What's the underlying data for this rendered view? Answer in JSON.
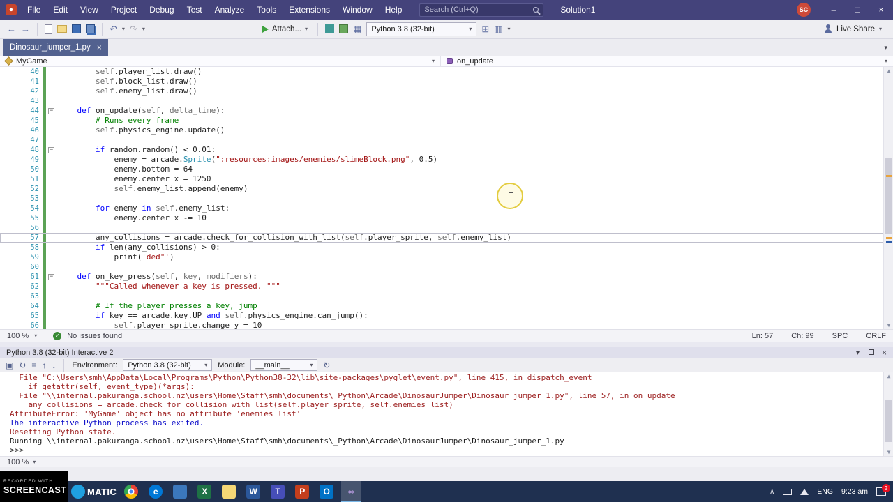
{
  "titlebar": {
    "menus": [
      "File",
      "Edit",
      "View",
      "Project",
      "Debug",
      "Test",
      "Analyze",
      "Tools",
      "Extensions",
      "Window",
      "Help"
    ],
    "search_placeholder": "Search (Ctrl+Q)",
    "solution": "Solution1",
    "avatar_initials": "SC"
  },
  "toolbar": {
    "attach_label": "Attach...",
    "python_version": "Python 3.8 (32-bit)",
    "live_share_label": "Live Share"
  },
  "tabbar": {
    "tabs": [
      {
        "label": "Dinosaur_jumper_1.py"
      }
    ]
  },
  "breadcrumb": {
    "left": "MyGame",
    "right": "on_update"
  },
  "editor": {
    "current_line": 57,
    "lines": [
      {
        "n": 40,
        "seg": [
          [
            "p",
            "        "
          ],
          [
            "g",
            "self"
          ],
          [
            "p",
            ".player_list.draw()"
          ]
        ]
      },
      {
        "n": 41,
        "seg": [
          [
            "p",
            "        "
          ],
          [
            "g",
            "self"
          ],
          [
            "p",
            ".block_list.draw()"
          ]
        ]
      },
      {
        "n": 42,
        "seg": [
          [
            "p",
            "        "
          ],
          [
            "g",
            "self"
          ],
          [
            "p",
            ".enemy_list.draw()"
          ]
        ]
      },
      {
        "n": 43,
        "seg": []
      },
      {
        "n": 44,
        "fold": true,
        "seg": [
          [
            "p",
            "    "
          ],
          [
            "k",
            "def"
          ],
          [
            "p",
            " on_update("
          ],
          [
            "g",
            "self"
          ],
          [
            "p",
            ", "
          ],
          [
            "g",
            "delta_time"
          ],
          [
            "p",
            "):"
          ]
        ]
      },
      {
        "n": 45,
        "seg": [
          [
            "p",
            "        "
          ],
          [
            "c",
            "# Runs every frame"
          ]
        ]
      },
      {
        "n": 46,
        "seg": [
          [
            "p",
            "        "
          ],
          [
            "g",
            "self"
          ],
          [
            "p",
            ".physics_engine.update()"
          ]
        ]
      },
      {
        "n": 47,
        "seg": []
      },
      {
        "n": 48,
        "fold": true,
        "seg": [
          [
            "p",
            "        "
          ],
          [
            "k",
            "if"
          ],
          [
            "p",
            " random.random() < 0.01:"
          ]
        ]
      },
      {
        "n": 49,
        "seg": [
          [
            "p",
            "            enemy = arcade."
          ],
          [
            "t",
            "Sprite"
          ],
          [
            "p",
            "("
          ],
          [
            "s",
            "\":resources:images/enemies/slimeBlock.png\""
          ],
          [
            "p",
            ", 0.5)"
          ]
        ]
      },
      {
        "n": 50,
        "seg": [
          [
            "p",
            "            enemy.bottom = 64"
          ]
        ]
      },
      {
        "n": 51,
        "seg": [
          [
            "p",
            "            enemy.center_x = 1250"
          ]
        ]
      },
      {
        "n": 52,
        "seg": [
          [
            "p",
            "            "
          ],
          [
            "g",
            "self"
          ],
          [
            "p",
            ".enemy_list.append(enemy)"
          ]
        ]
      },
      {
        "n": 53,
        "seg": []
      },
      {
        "n": 54,
        "seg": [
          [
            "p",
            "        "
          ],
          [
            "k",
            "for"
          ],
          [
            "p",
            " enemy "
          ],
          [
            "k",
            "in"
          ],
          [
            "p",
            " "
          ],
          [
            "g",
            "self"
          ],
          [
            "p",
            ".enemy_list:"
          ]
        ]
      },
      {
        "n": 55,
        "seg": [
          [
            "p",
            "            enemy.center_x -= 10"
          ]
        ]
      },
      {
        "n": 56,
        "seg": []
      },
      {
        "n": 57,
        "seg": [
          [
            "p",
            "        any_collisions = arcade.check_for_collision_with_list("
          ],
          [
            "g",
            "self"
          ],
          [
            "p",
            ".player_sprite, "
          ],
          [
            "g",
            "self"
          ],
          [
            "p",
            ".enemy_list)"
          ]
        ]
      },
      {
        "n": 58,
        "seg": [
          [
            "p",
            "        "
          ],
          [
            "k",
            "if"
          ],
          [
            "p",
            " len(any_collisions) > 0:"
          ]
        ]
      },
      {
        "n": 59,
        "seg": [
          [
            "p",
            "            print("
          ],
          [
            "s",
            "'ded\"'"
          ],
          [
            "p",
            ")"
          ]
        ]
      },
      {
        "n": 60,
        "seg": []
      },
      {
        "n": 61,
        "fold": true,
        "seg": [
          [
            "p",
            "    "
          ],
          [
            "k",
            "def"
          ],
          [
            "p",
            " on_key_press("
          ],
          [
            "g",
            "self"
          ],
          [
            "p",
            ", "
          ],
          [
            "g",
            "key"
          ],
          [
            "p",
            ", "
          ],
          [
            "g",
            "modifiers"
          ],
          [
            "p",
            "):"
          ]
        ]
      },
      {
        "n": 62,
        "seg": [
          [
            "p",
            "        "
          ],
          [
            "s",
            "\"\"\"Called whenever a key is pressed. \"\"\""
          ]
        ]
      },
      {
        "n": 63,
        "seg": []
      },
      {
        "n": 64,
        "seg": [
          [
            "p",
            "        "
          ],
          [
            "c",
            "# If the player presses a key, jump"
          ]
        ]
      },
      {
        "n": 65,
        "seg": [
          [
            "p",
            "        "
          ],
          [
            "k",
            "if"
          ],
          [
            "p",
            " key == arcade.key.UP "
          ],
          [
            "k",
            "and"
          ],
          [
            "p",
            " "
          ],
          [
            "g",
            "self"
          ],
          [
            "p",
            ".physics_engine.can_jump():"
          ]
        ]
      },
      {
        "n": 66,
        "seg": [
          [
            "p",
            "            "
          ],
          [
            "g",
            "self"
          ],
          [
            "p",
            ".player_sprite.change_y = 10"
          ]
        ]
      }
    ]
  },
  "editor_status": {
    "zoom": "100 %",
    "issues": "No issues found",
    "ln": "Ln: 57",
    "ch": "Ch: 99",
    "enc": "SPC",
    "eol": "CRLF"
  },
  "interactive": {
    "title": "Python 3.8 (32-bit) Interactive 2",
    "environment_label": "Environment:",
    "environment_value": "Python 3.8 (32-bit)",
    "module_label": "Module:",
    "module_value": "__main__",
    "console": [
      {
        "c": "err",
        "t": "  File \"C:\\Users\\smh\\AppData\\Local\\Programs\\Python\\Python38-32\\lib\\site-packages\\pyglet\\event.py\", line 415, in dispatch_event"
      },
      {
        "c": "err",
        "t": "    if getattr(self, event_type)(*args):"
      },
      {
        "c": "err",
        "t": "  File \"\\\\internal.pakuranga.school.nz\\users\\Home\\Staff\\smh\\documents\\_Python\\Arcade\\DinosaurJumper\\Dinosaur_jumper_1.py\", line 57, in on_update"
      },
      {
        "c": "err",
        "t": "    any_collisions = arcade.check_for_collision_with_list(self.player_sprite, self.enemies_list)"
      },
      {
        "c": "err",
        "t": "AttributeError: 'MyGame' object has no attribute 'enemies_list'"
      },
      {
        "c": "info",
        "t": "The interactive Python process has exited."
      },
      {
        "c": "err",
        "t": "Resetting Python state."
      },
      {
        "c": "plain",
        "t": "Running \\\\internal.pakuranga.school.nz\\users\\Home\\Staff\\smh\\documents\\_Python\\Arcade\\DinosaurJumper\\Dinosaur_jumper_1.py"
      },
      {
        "c": "plain",
        "t": ">>> ",
        "cursor": true
      }
    ],
    "zoom": "100 %"
  },
  "watermark": {
    "small": "RECORDED WITH",
    "big": "SCREENCAST",
    "suffix": "MATIC"
  },
  "taskbar": {
    "icons": [
      {
        "name": "taskbar-icon-chrome",
        "shape": "circle",
        "bg": "conic-gradient(#EA4335 0deg 120deg, #FBBC05 120deg 240deg, #34A853 240deg 360deg)",
        "glyph": "",
        "fg": "#ffffff",
        "dot": true
      },
      {
        "name": "taskbar-icon-edge",
        "shape": "circle",
        "bg": "#0078D7",
        "glyph": "e",
        "fg": "#ffffff"
      },
      {
        "name": "taskbar-icon-vscode",
        "shape": "square",
        "bg": "#3B77BC",
        "glyph": "",
        "fg": "#ffffff"
      },
      {
        "name": "taskbar-icon-excel",
        "shape": "square",
        "bg": "#1E7145",
        "glyph": "X",
        "fg": "#ffffff"
      },
      {
        "name": "taskbar-icon-folder",
        "shape": "square",
        "bg": "#F5D776",
        "glyph": "",
        "fg": "#9A7B2A"
      },
      {
        "name": "taskbar-icon-word",
        "shape": "square",
        "bg": "#2B579A",
        "glyph": "W",
        "fg": "#ffffff"
      },
      {
        "name": "taskbar-icon-teams",
        "shape": "square",
        "bg": "#464EB8",
        "glyph": "T",
        "fg": "#ffffff"
      },
      {
        "name": "taskbar-icon-powerpoint",
        "shape": "square",
        "bg": "#C43E1C",
        "glyph": "P",
        "fg": "#ffffff"
      },
      {
        "name": "taskbar-icon-outlook",
        "shape": "square",
        "bg": "#0072C6",
        "glyph": "O",
        "fg": "#ffffff"
      },
      {
        "name": "taskbar-icon-visual-studio",
        "shape": "square",
        "bg": "transparent",
        "glyph": "∞",
        "fg": "#B79BE0",
        "active": true
      }
    ],
    "language": "ENG",
    "time": "9:23 am",
    "badge": "2"
  }
}
